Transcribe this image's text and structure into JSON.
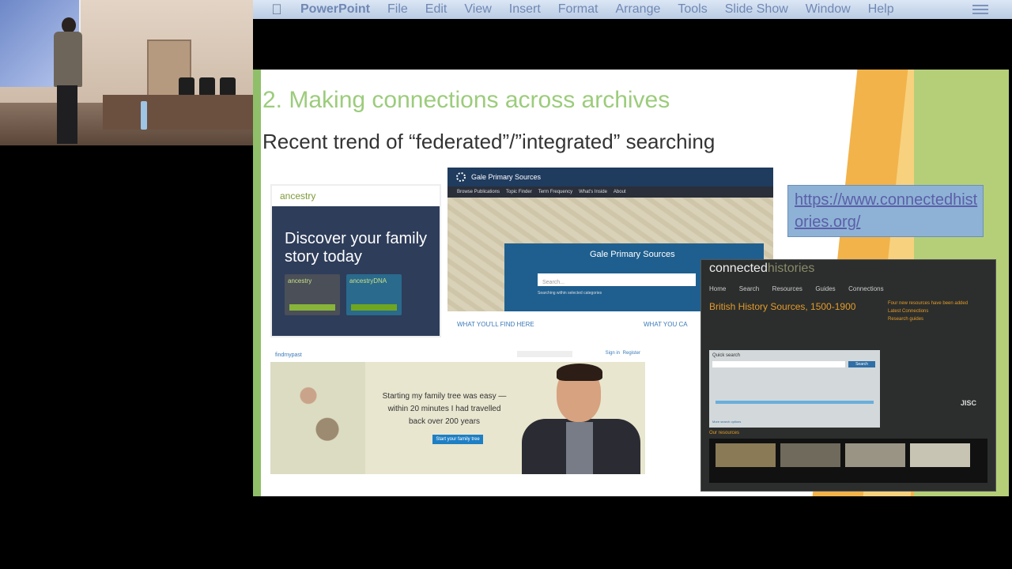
{
  "menubar": {
    "app": "PowerPoint",
    "items": [
      "File",
      "Edit",
      "View",
      "Insert",
      "Format",
      "Arrange",
      "Tools",
      "Slide Show",
      "Window",
      "Help"
    ]
  },
  "slide": {
    "title": "2. Making connections across archives",
    "subtitle": "Recent trend of “federated”/”integrated” searching",
    "url": "https://www.connectedhistories.org/"
  },
  "ancestry": {
    "logo": "ancestry",
    "tagline": "Discover your family story today",
    "card1_title": "ancestry",
    "card2_title": "ancestryDNA"
  },
  "gale": {
    "header": "Gale Primary Sources",
    "nav": [
      "Browse Publications",
      "Topic Finder",
      "Term Frequency",
      "What's Inside",
      "About"
    ],
    "box_title": "Gale Primary Sources",
    "search_placeholder": "Search...",
    "within": "Searching within selected categories"
  },
  "whatfind": {
    "heading1": "WHAT YOU'LL FIND HERE",
    "heading2": "WHAT YOU CA"
  },
  "findmypast": {
    "logo": "findmypast",
    "sign_in": "Sign in",
    "register": "Register",
    "quote": "Starting my family tree was easy — within 20 minutes I had travelled back over 200 years",
    "cta": "Start your family tree"
  },
  "connected": {
    "logo_a": "connected",
    "logo_b": "histories",
    "nav": [
      "Home",
      "Search",
      "Resources",
      "Guides",
      "Connections"
    ],
    "hero": "British History Sources, 1500-1900",
    "right_h1": "Four new resources have been added",
    "right_h2": "Latest Connections",
    "right_h3": "Research guides",
    "quick_search": "Quick search",
    "search_btn": "Search",
    "more_search": "More search options",
    "our_resources": "Our resources",
    "funded": "JISC"
  }
}
